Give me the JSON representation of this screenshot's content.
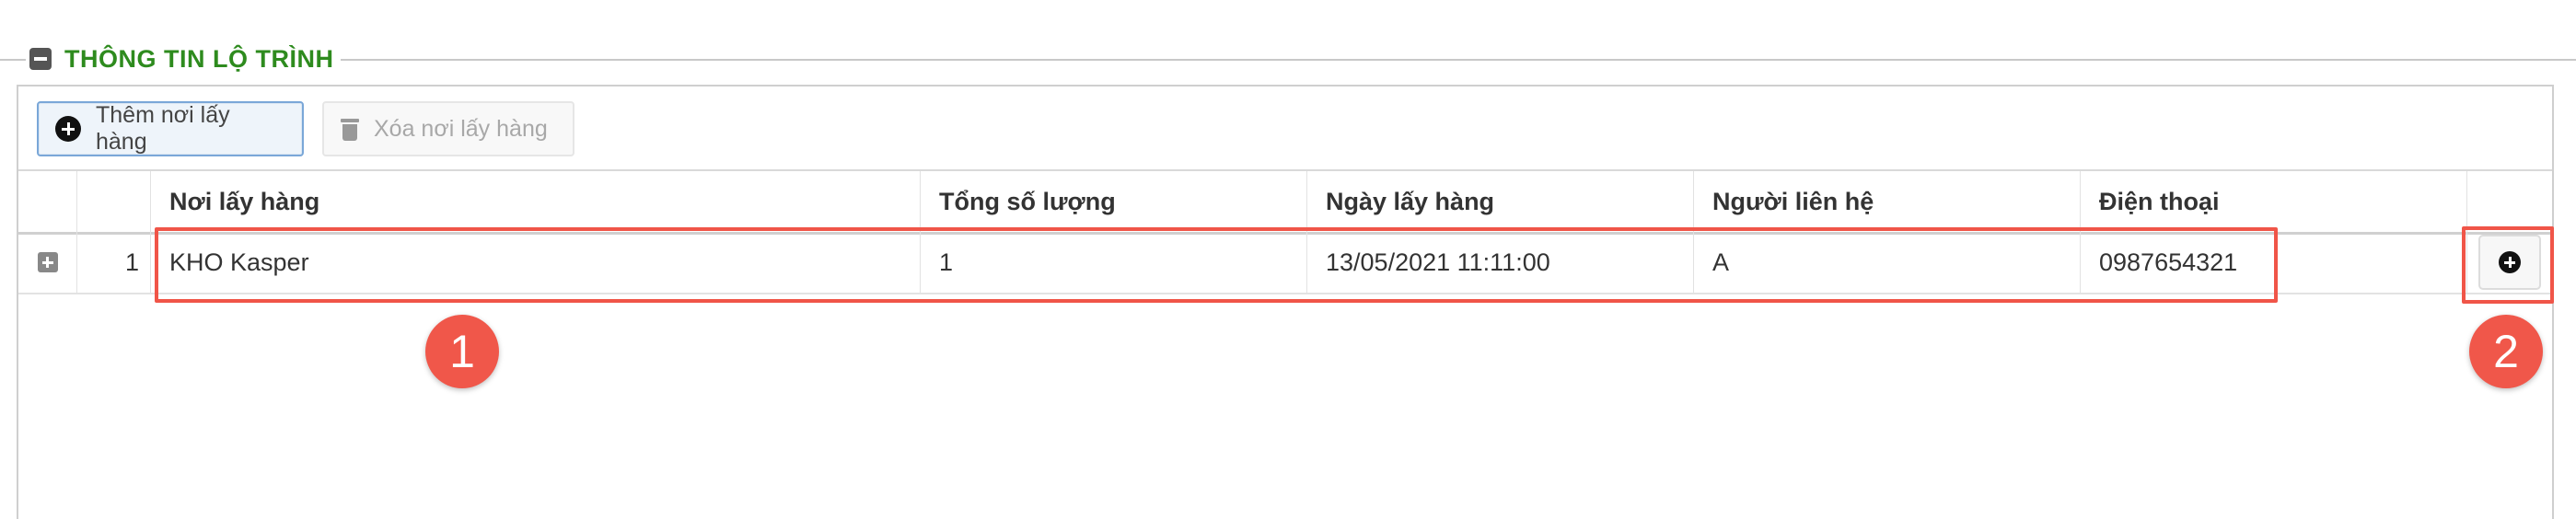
{
  "section": {
    "title": "THÔNG TIN LỘ TRÌNH"
  },
  "toolbar": {
    "add_label": "Thêm nơi lấy hàng",
    "delete_label": "Xóa nơi lấy hàng"
  },
  "table": {
    "columns": {
      "place": "Nơi lấy hàng",
      "quantity": "Tổng số lượng",
      "date": "Ngày lấy hàng",
      "contact": "Người liên hệ",
      "phone": "Điện thoại"
    },
    "rows": [
      {
        "no": "1",
        "place": "KHO Kasper",
        "quantity": "1",
        "date": "13/05/2021 11:11:00",
        "contact": "A",
        "phone": "0987654321"
      }
    ]
  },
  "annotations": {
    "badge_1": "1",
    "badge_2": "2"
  },
  "colors": {
    "section_title": "#2e8b1e",
    "annotation": "#f05548"
  },
  "icons": {
    "collapse": "minus-box-icon",
    "add": "plus-circle-icon",
    "delete": "trash-icon",
    "expand_row": "plus-box-icon"
  }
}
